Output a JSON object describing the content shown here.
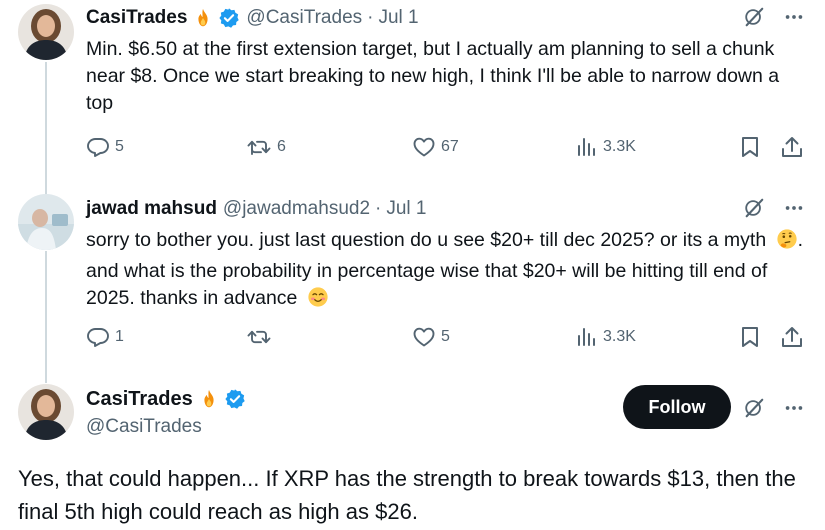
{
  "tweets": [
    {
      "author_name": "CasiTrades",
      "author_handle": "@CasiTrades",
      "date_sep": "·",
      "date": "Jul 1",
      "text": "Min. $6.50 at the first extension target, but I actually am planning to sell a chunk near $8. Once we start breaking to new high, I think I'll be able to narrow down a top",
      "replies": "5",
      "reposts": "6",
      "likes": "67",
      "views": "3.3K"
    },
    {
      "author_name": "jawad mahsud",
      "author_handle": "@jawadmahsud2",
      "date_sep": "·",
      "date": "Jul 1",
      "text_part1": "sorry to bother you. just last question do u see $20+ till dec 2025? or its a myth",
      "text_part2": ". and what is the probability in percentage wise that $20+ will be hitting till end of 2025. thanks in advance",
      "replies": "1",
      "reposts": "",
      "likes": "5",
      "views": "3.3K"
    },
    {
      "author_name": "CasiTrades",
      "author_handle": "@CasiTrades",
      "text": "Yes, that could happen... If XRP has the strength to break towards $13, then the final 5th high could reach as high as $26.",
      "follow_label": "Follow"
    }
  ],
  "icons": {
    "fire": "fire-emoji",
    "verified": "verified-badge-icon",
    "grok": "grok-icon",
    "more": "more-icon",
    "reply": "reply-icon",
    "repost": "repost-icon",
    "like": "like-icon",
    "views": "views-icon",
    "bookmark": "bookmark-icon",
    "share": "share-icon",
    "thinking": "thinking-face-emoji",
    "smiling": "smiling-face-emoji"
  },
  "colors": {
    "text_primary": "#0f1419",
    "text_secondary": "#536471",
    "verified_blue": "#1d9bf0",
    "follow_bg": "#0f1419",
    "thread_line": "#cfd9de"
  }
}
